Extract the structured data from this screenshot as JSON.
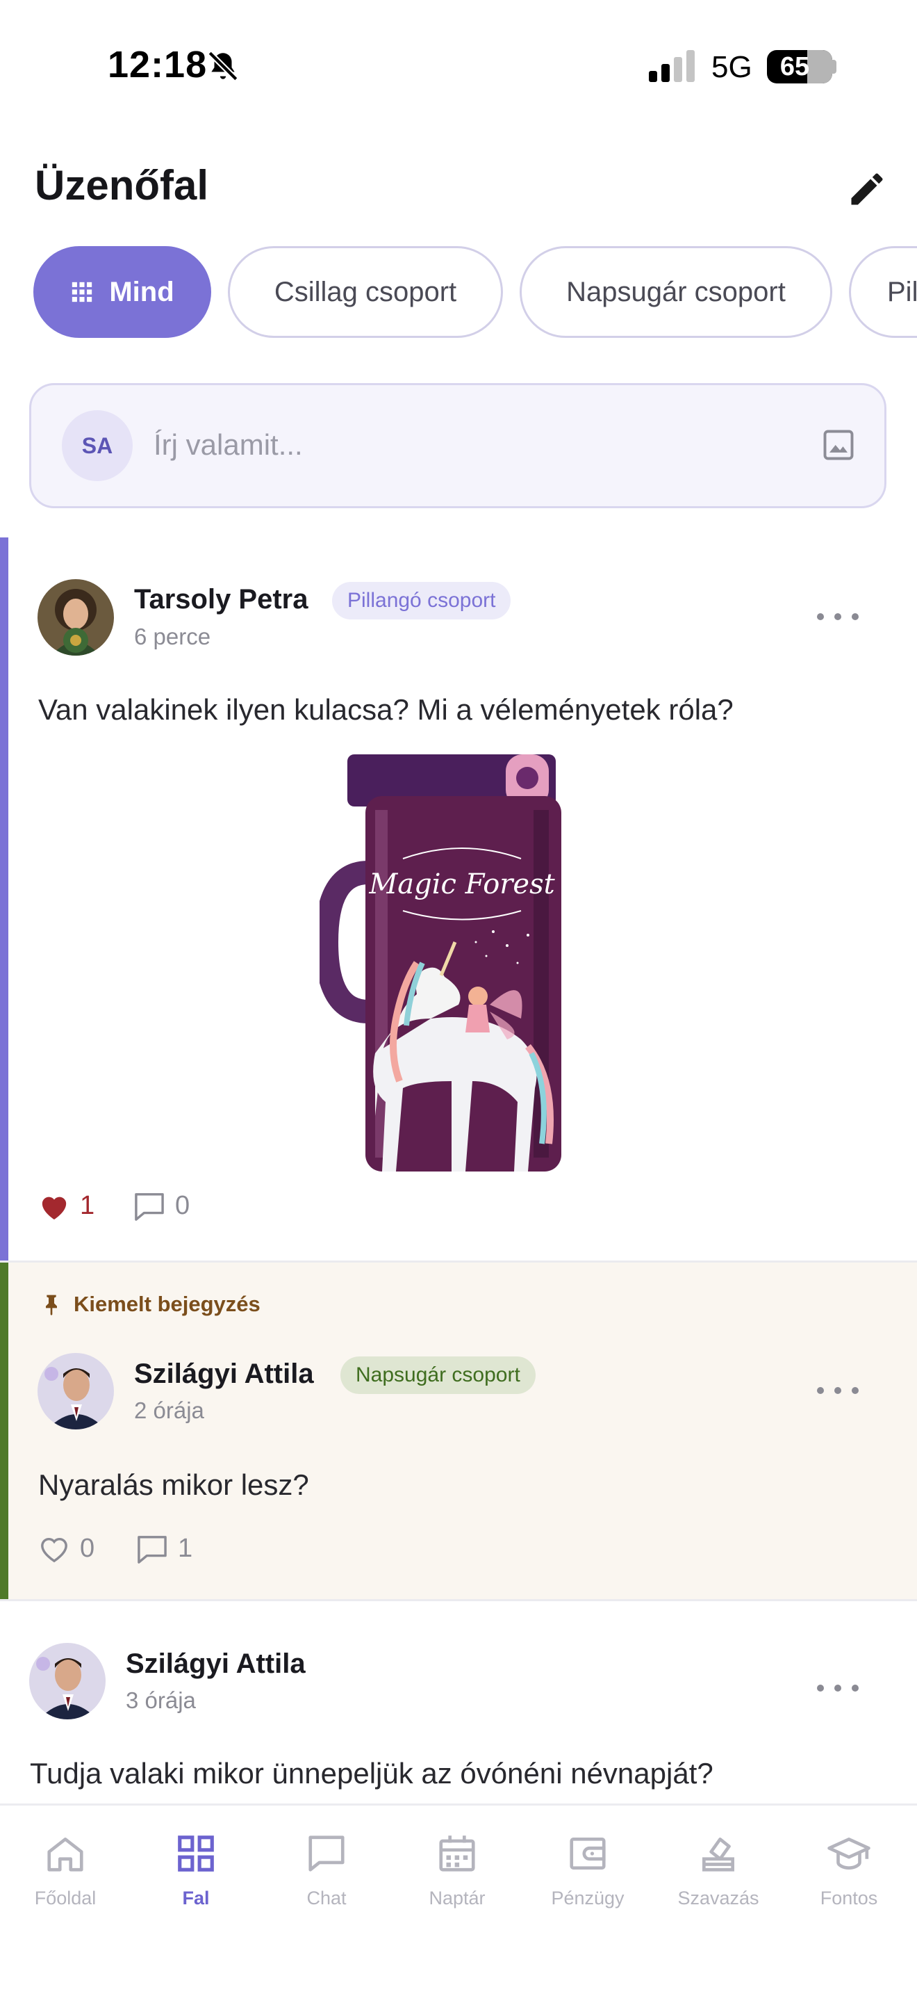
{
  "status_bar": {
    "time": "12:18",
    "network": "5G",
    "battery": "65"
  },
  "header": {
    "title": "Üzenőfal"
  },
  "filters": {
    "chips": [
      {
        "label": "Mind",
        "active": true
      },
      {
        "label": "Csillag csoport",
        "active": false
      },
      {
        "label": "Napsugár csoport",
        "active": false
      },
      {
        "label": "Pil",
        "active": false
      }
    ]
  },
  "composer": {
    "initials": "SA",
    "placeholder": "Írj valamit..."
  },
  "posts": [
    {
      "author": "Tarsoly Petra",
      "group": "Pillangó csoport",
      "time": "6 perce",
      "text": "Van valakinek ilyen kulacsa? Mi a véleményetek róla?",
      "image_text": "Magic Forest",
      "likes": "1",
      "liked": true,
      "comments": "0"
    },
    {
      "pinned_label": "Kiemelt bejegyzés",
      "author": "Szilágyi Attila",
      "group": "Napsugár csoport",
      "time": "2 órája",
      "text": "Nyaralás mikor lesz?",
      "likes": "0",
      "liked": false,
      "comments": "1"
    },
    {
      "author": "Szilágyi Attila",
      "time": "3 órája",
      "text": "Tudja valaki mikor ünnepeljük az óvónéni névnapját?"
    }
  ],
  "nav": {
    "items": [
      {
        "label": "Főoldal",
        "icon": "home-icon",
        "active": false
      },
      {
        "label": "Fal",
        "icon": "grid-icon",
        "active": true
      },
      {
        "label": "Chat",
        "icon": "chat-icon",
        "active": false
      },
      {
        "label": "Naptár",
        "icon": "calendar-icon",
        "active": false
      },
      {
        "label": "Pénzügy",
        "icon": "wallet-icon",
        "active": false
      },
      {
        "label": "Szavazás",
        "icon": "vote-icon",
        "active": false
      },
      {
        "label": "Fontos",
        "icon": "graduation-cap-icon",
        "active": false
      }
    ]
  },
  "colors": {
    "accent": "#7b72d6",
    "pinned_accent": "#4f7a2a",
    "pinned_background": "#faf6f0",
    "like": "#a3282e"
  }
}
